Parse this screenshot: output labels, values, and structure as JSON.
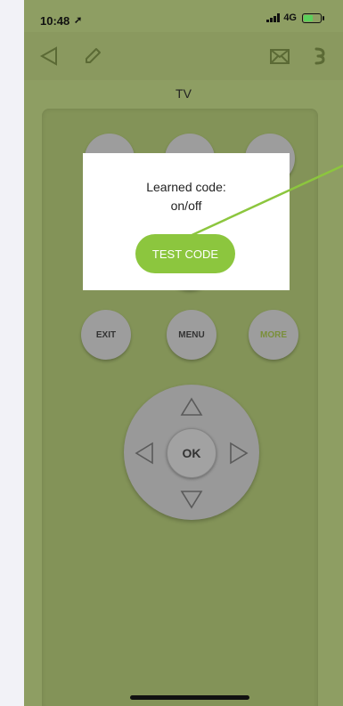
{
  "status_bar": {
    "time": "10:48",
    "network": "4G",
    "battery_color": "#5bd05b"
  },
  "toolbar": {
    "icons": [
      "back-icon",
      "edit-icon",
      "mail-icon",
      "menu-icon"
    ]
  },
  "page": {
    "title": "TV"
  },
  "remote": {
    "buttons": {
      "exit": "EXIT",
      "menu": "MENU",
      "more": "MORE"
    },
    "dpad": {
      "ok": "OK",
      "arrows": [
        "up-arrow-icon",
        "down-arrow-icon",
        "left-arrow-icon",
        "right-arrow-icon"
      ]
    }
  },
  "dialog": {
    "line1": "Learned code:",
    "line2": "on/off",
    "test_button": "TEST CODE",
    "accent_color": "#8cc63e"
  },
  "colors": {
    "screen_bg": "#8e9e63",
    "remote_bg": "#839358",
    "button_gray": "#9d9d9d"
  }
}
